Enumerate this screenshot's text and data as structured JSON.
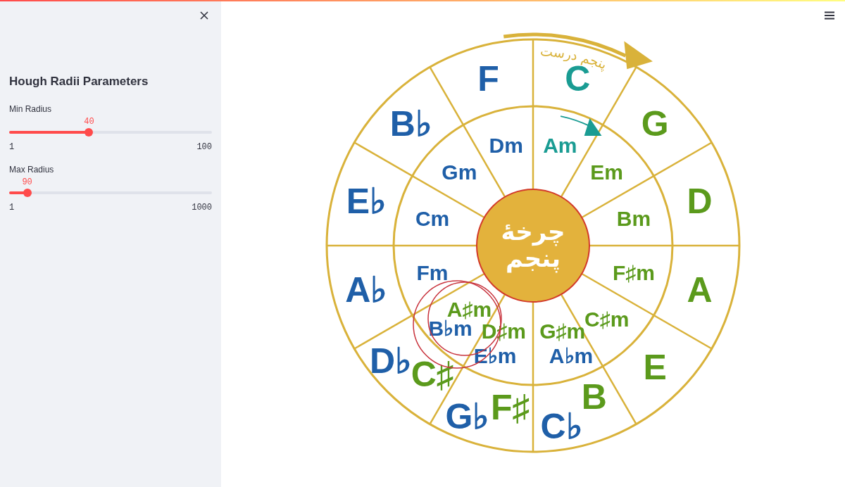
{
  "sidebar": {
    "title": "Hough Radii Parameters",
    "sliders": [
      {
        "label": "Min Radius",
        "value": "40",
        "level": 0.394,
        "min": "1",
        "max": "100"
      },
      {
        "label": "Max Radius",
        "value": "90",
        "level": 0.089,
        "min": "1",
        "max": "1000"
      }
    ]
  },
  "wheel": {
    "center_lines": [
      "چرخهٔ",
      "پنجم"
    ],
    "arc_caption": "پنجم درست",
    "outer": [
      {
        "labels": [
          {
            "text": "C",
            "color": "#1a9c93"
          }
        ]
      },
      {
        "labels": [
          {
            "text": "G",
            "color": "#5b9a1c"
          }
        ]
      },
      {
        "labels": [
          {
            "text": "D",
            "color": "#5b9a1c"
          }
        ]
      },
      {
        "labels": [
          {
            "text": "A",
            "color": "#5b9a1c"
          }
        ]
      },
      {
        "labels": [
          {
            "text": "E",
            "color": "#5b9a1c"
          }
        ]
      },
      {
        "labels": [
          {
            "text": "B",
            "color": "#5b9a1c"
          },
          {
            "text": "C♭",
            "color": "#1f5fa8"
          }
        ]
      },
      {
        "labels": [
          {
            "text": "G♭",
            "color": "#1f5fa8"
          },
          {
            "text": "F♯",
            "color": "#5b9a1c"
          }
        ]
      },
      {
        "labels": [
          {
            "text": "D♭",
            "color": "#1f5fa8"
          },
          {
            "text": "C♯",
            "color": "#5b9a1c"
          }
        ]
      },
      {
        "labels": [
          {
            "text": "A♭",
            "color": "#1f5fa8"
          }
        ]
      },
      {
        "labels": [
          {
            "text": "E♭",
            "color": "#1f5fa8"
          }
        ]
      },
      {
        "labels": [
          {
            "text": "B♭",
            "color": "#1f5fa8"
          }
        ]
      },
      {
        "labels": [
          {
            "text": "F",
            "color": "#1f5fa8"
          }
        ]
      }
    ],
    "inner": [
      {
        "labels": [
          {
            "text": "Am",
            "color": "#1a9c93"
          }
        ]
      },
      {
        "labels": [
          {
            "text": "Em",
            "color": "#5b9a1c"
          }
        ]
      },
      {
        "labels": [
          {
            "text": "Bm",
            "color": "#5b9a1c"
          }
        ]
      },
      {
        "labels": [
          {
            "text": "F♯m",
            "color": "#5b9a1c"
          }
        ]
      },
      {
        "labels": [
          {
            "text": "C♯m",
            "color": "#5b9a1c"
          }
        ]
      },
      {
        "labels": [
          {
            "text": "G♯m",
            "color": "#5b9a1c"
          },
          {
            "text": "A♭m",
            "color": "#1f5fa8"
          }
        ]
      },
      {
        "labels": [
          {
            "text": "D♯m",
            "color": "#5b9a1c"
          },
          {
            "text": "E♭m",
            "color": "#1f5fa8"
          }
        ]
      },
      {
        "labels": [
          {
            "text": "A♯m",
            "color": "#5b9a1c"
          },
          {
            "text": "B♭m",
            "color": "#1f5fa8"
          }
        ]
      },
      {
        "labels": [
          {
            "text": "Fm",
            "color": "#1f5fa8"
          }
        ]
      },
      {
        "labels": [
          {
            "text": "Cm",
            "color": "#1f5fa8"
          }
        ]
      },
      {
        "labels": [
          {
            "text": "Gm",
            "color": "#1f5fa8"
          }
        ]
      },
      {
        "labels": [
          {
            "text": "Dm",
            "color": "#1f5fa8"
          }
        ]
      }
    ]
  }
}
